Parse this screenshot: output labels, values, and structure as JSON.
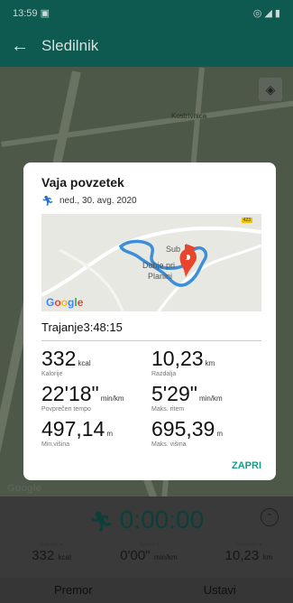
{
  "status": {
    "time": "13:59 ▣",
    "icons": "◎ ◢ ▮"
  },
  "appbar": {
    "back": "←",
    "title": "Sledilnik"
  },
  "bgmap": {
    "place": "Kostrivnica",
    "google": "Google",
    "locate_icon": "target-icon"
  },
  "dialog": {
    "title": "Vaja povzetek",
    "date": "ned., 30. avg. 2020",
    "map": {
      "places": [
        "Sub",
        "Dobje pri",
        "Planini"
      ],
      "badge": "423",
      "google": "Google"
    },
    "duration_label": "Trajanje",
    "duration_value": "3:48:15",
    "stats": [
      {
        "value": "332",
        "unit": "kcal",
        "label": "Kalorije"
      },
      {
        "value": "10,23",
        "unit": "km",
        "label": "Razdalja"
      },
      {
        "value": "22'18\"",
        "unit": "min/km",
        "label": "Povprečen tempo"
      },
      {
        "value": "5'29\"",
        "unit": "min/km",
        "label": "Maks. ritem"
      },
      {
        "value": "497,14",
        "unit": "m",
        "label": "Min.višina"
      },
      {
        "value": "695,39",
        "unit": "m",
        "label": "Maks. višina"
      }
    ],
    "close": "ZAPRI"
  },
  "tracker": {
    "timer": "0:00:00",
    "stats": [
      {
        "label": "Kalorije ▾",
        "value": "332",
        "unit": "kcal"
      },
      {
        "label": "Tempo ▾",
        "value": "0'00\"",
        "unit": "min/km"
      },
      {
        "label": "Razdalja ▾",
        "value": "10,23",
        "unit": "km"
      }
    ],
    "pause": "Premor",
    "stop": "Ustavi"
  }
}
